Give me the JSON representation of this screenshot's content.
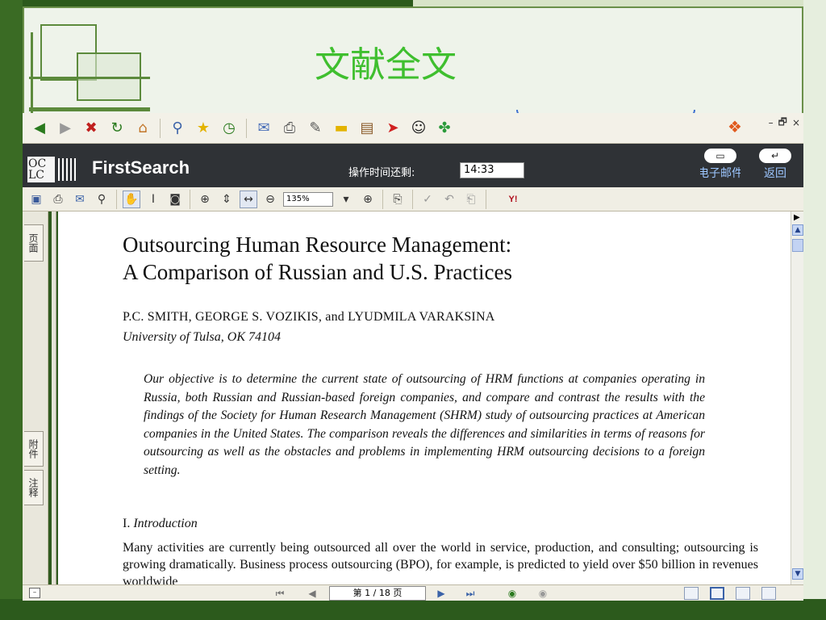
{
  "slide": {
    "title": "文献全文"
  },
  "browser_toolbar": {
    "icons": [
      "back-icon",
      "forward-icon",
      "stop-icon",
      "refresh-icon",
      "home-icon",
      "search-icon",
      "favorites-icon",
      "history-icon",
      "mail-icon",
      "print-icon",
      "edit-icon",
      "folder-icon",
      "research-icon",
      "messenger-icon",
      "qq-icon",
      "msn-icon"
    ],
    "window_controls": [
      "–",
      "🗗",
      "×"
    ]
  },
  "firstsearch": {
    "logo_text": "OC LC",
    "brand": "FirstSearch",
    "time_label": "操作时间还剩:",
    "time_value": "14:33",
    "email_label": "电子邮件",
    "back_label": "返回"
  },
  "pdf_toolbar": {
    "zoom": "135%"
  },
  "side_tabs": {
    "pages": "页面",
    "attachments": "附件",
    "comments": "注释"
  },
  "document": {
    "title_line1": "Outsourcing Human Resource Management:",
    "title_line2": "A Comparison of Russian and U.S. Practices",
    "authors": "P.C. SMITH, GEORGE S. VOZIKIS, and LYUDMILA VARAKSINA",
    "affiliation": "University of Tulsa, OK 74104",
    "abstract": "Our objective is to determine the current state of outsourcing of HRM functions at companies operating in Russia, both Russian and Russian-based foreign companies, and compare and contrast the results with the findings of the Society for Human Research Management (SHRM) study of outsourcing practices at American companies in the United States. The comparison reveals the differences and similarities in terms of reasons for outsourcing as well as the obstacles and problems in implementing HRM outsourcing decisions to a foreign setting.",
    "section_number": "I.",
    "section_title": "Introduction",
    "body": "Many activities are currently being outsourced all over the world in service, production, and consulting; outsourcing is growing dramatically. Business process outsourcing (BPO), for example, is predicted to yield over $50 billion in revenues worldwide"
  },
  "status_bar": {
    "page_indicator": "第 1 / 18 页"
  }
}
